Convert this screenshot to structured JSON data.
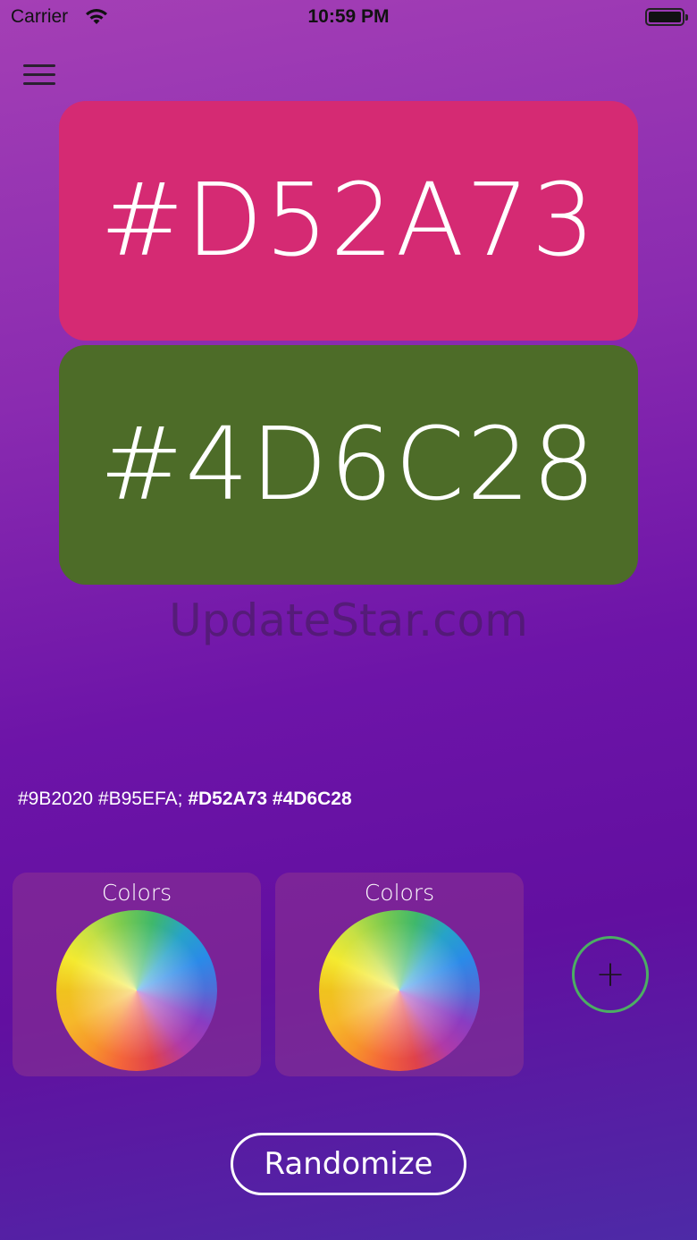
{
  "status_bar": {
    "carrier": "Carrier",
    "time": "10:59 PM"
  },
  "swatches": [
    {
      "hex": "#D52A73",
      "color": "#D52A73"
    },
    {
      "hex": "#4D6C28",
      "color": "#4D6C28"
    }
  ],
  "watermark": "UpdateStar.com",
  "palette": {
    "regular": "#9B2020 #B95EFA;",
    "bold": "#D52A73 #4D6C28"
  },
  "cards": [
    {
      "label": "Colors"
    },
    {
      "label": "Colors"
    }
  ],
  "add_button_icon": "plus-icon",
  "randomize_label": "Randomize",
  "colors": {
    "accent_ring": "#4CAE63",
    "background_top": "#A43FB5",
    "background_bottom": "#4D2AA6"
  }
}
